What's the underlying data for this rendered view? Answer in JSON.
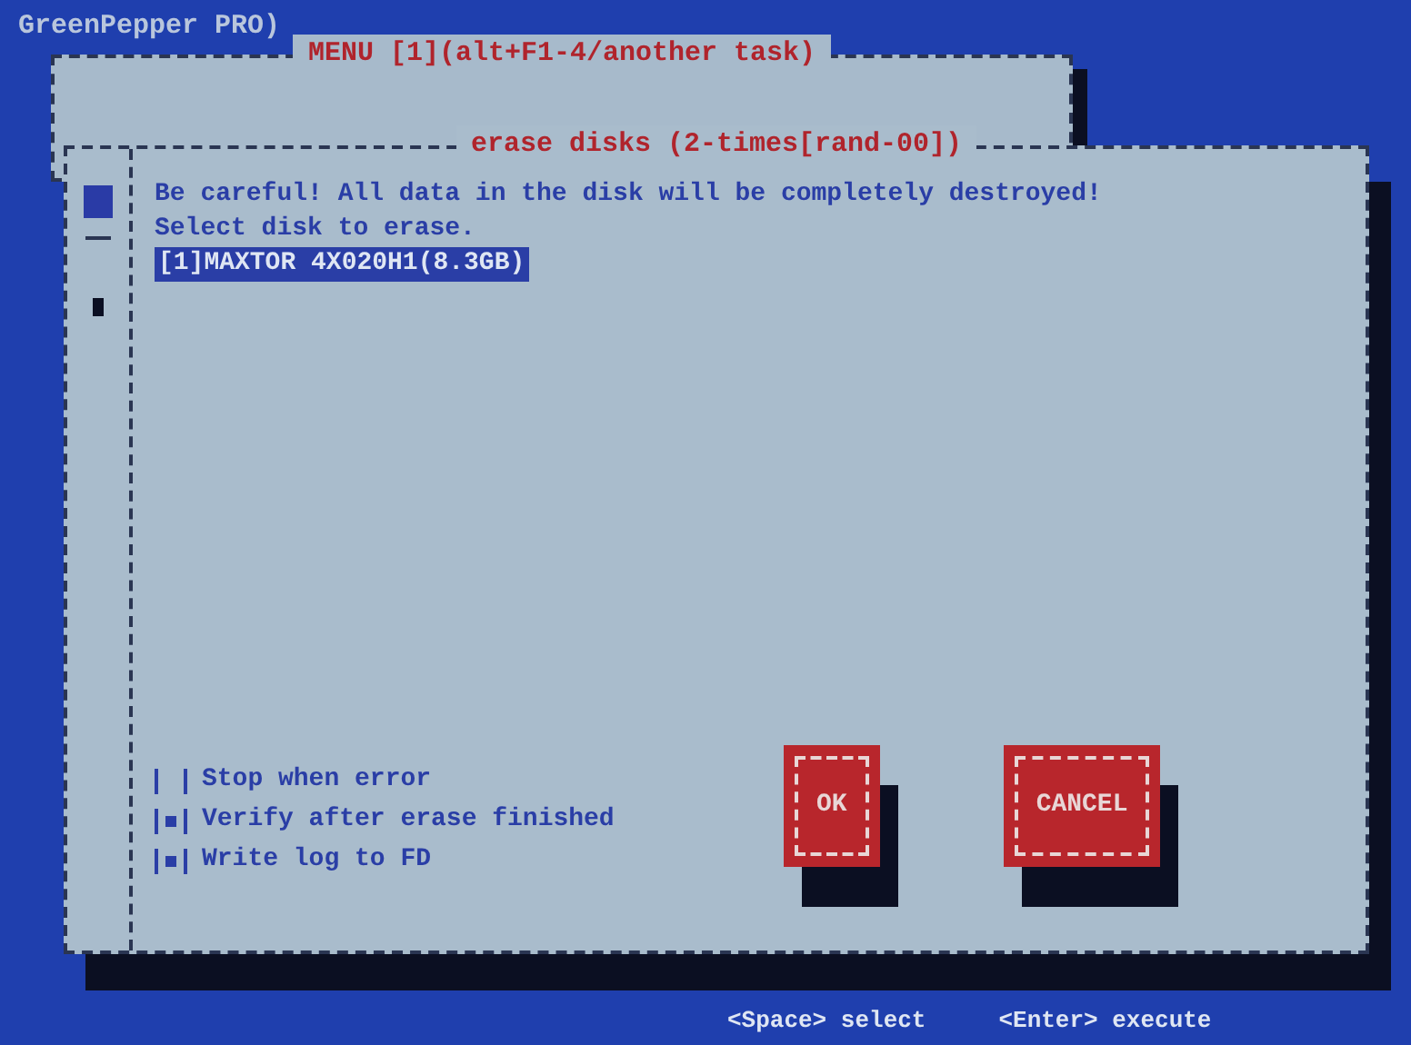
{
  "header": {
    "title": "GreenPepper PRO)"
  },
  "menu": {
    "title": "MENU [1](alt+F1-4/another task)"
  },
  "dialog": {
    "title": "erase disks (2-times[rand-00])",
    "warning": "Be careful! All data in the disk will be completely destroyed!",
    "prompt": "Select disk to erase.",
    "disks": [
      {
        "label": "[1]MAXTOR 4X020H1(8.3GB)",
        "selected": true
      }
    ],
    "options": [
      {
        "label": "Stop when error",
        "checked": false
      },
      {
        "label": "Verify after erase finished",
        "checked": true
      },
      {
        "label": "Write log to FD",
        "checked": true
      }
    ],
    "buttons": [
      {
        "label": "OK"
      },
      {
        "label": "CANCEL"
      }
    ]
  },
  "status_bar": [
    "<Space> select",
    "<Enter> execute"
  ]
}
